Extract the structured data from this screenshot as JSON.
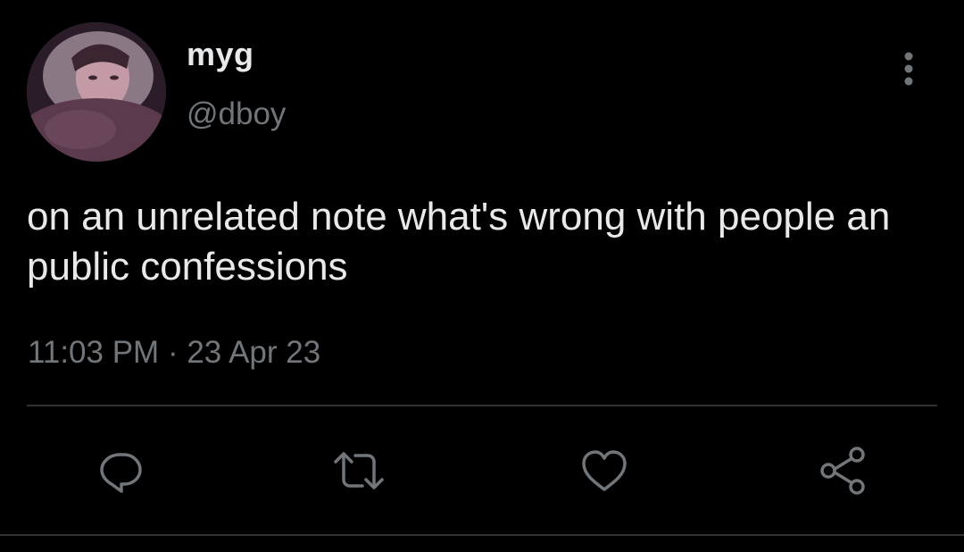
{
  "user": {
    "display_name": "myg",
    "handle": "@dboy"
  },
  "tweet": {
    "text": "on an unrelated note what's wrong with people an public confessions",
    "time": "11:03 PM",
    "separator": "·",
    "date": "23 Apr 23"
  },
  "icons": {
    "more": "more-vertical-icon",
    "reply": "reply-icon",
    "retweet": "retweet-icon",
    "like": "heart-icon",
    "share": "share-icon"
  },
  "colors": {
    "background": "#000000",
    "text_primary": "#e7e9ea",
    "text_secondary": "#71767b",
    "divider": "#2f3336"
  }
}
